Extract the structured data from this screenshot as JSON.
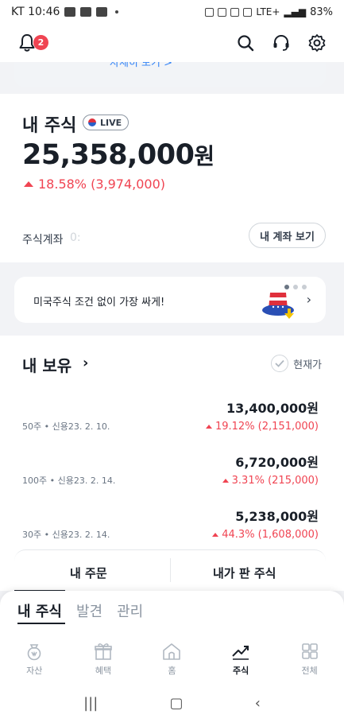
{
  "status_bar": {
    "carrier_time": "KT 10:46",
    "network": "LTE+",
    "battery": "83%"
  },
  "header": {
    "notification_count": "2"
  },
  "peek_card": {
    "link_text": "자세히 보기 >"
  },
  "portfolio": {
    "title": "내 주식",
    "live_badge": "LIVE",
    "total_amount": "25,358,000",
    "total_unit": "원",
    "change_text": "18.58% (3,974,000)"
  },
  "account": {
    "label": "주식계좌",
    "number_partial": "0:",
    "view_button": "내 계좌 보기"
  },
  "banner": {
    "text": "미국주식 조건 없이 가장 싸게!",
    "page_total": 3,
    "page_current": 1
  },
  "holdings": {
    "title": "내 보유",
    "current_price_toggle": "현재가",
    "rows": [
      {
        "meta": "50주 • 신용23. 2. 10.",
        "amount": "13,400,000원",
        "change": "19.12% (2,151,000)"
      },
      {
        "meta": "100주 • 신용23. 2. 14.",
        "amount": "6,720,000원",
        "change": "3.31% (215,000)"
      },
      {
        "meta": "30주 • 신용23. 2. 14.",
        "amount": "5,238,000원",
        "change": "44.3% (1,608,000)"
      }
    ]
  },
  "orders": {
    "tab_left": "내 주문",
    "tab_right": "내가 판 주식"
  },
  "sheet": {
    "tabs": [
      "내 주식",
      "발견",
      "관리"
    ]
  },
  "nav": {
    "items": [
      "자산",
      "혜택",
      "홈",
      "주식",
      "전체"
    ]
  },
  "colors": {
    "accent_red": "#f04452",
    "accent_blue": "#3182f6",
    "text_primary": "#191f28"
  }
}
